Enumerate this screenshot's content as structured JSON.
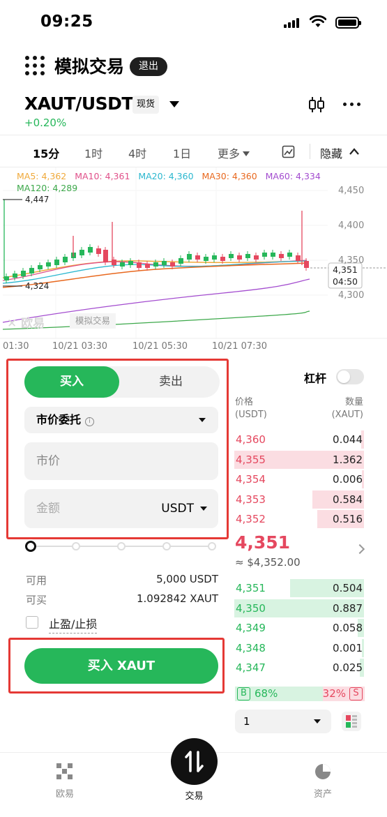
{
  "status": {
    "time": "09:25"
  },
  "header": {
    "title": "模拟交易",
    "exit_label": "退出"
  },
  "pair": {
    "name": "XAUT/USDT",
    "tag": "现货",
    "change": "+0.20%"
  },
  "timeframes": {
    "items": [
      "15分",
      "1时",
      "4时",
      "1日",
      "更多"
    ],
    "active": "15分",
    "hide_label": "隐藏"
  },
  "chart": {
    "ma": [
      {
        "label": "MA5: 4,362",
        "color": "#f0a93a"
      },
      {
        "label": "MA10: 4,361",
        "color": "#e0508a"
      },
      {
        "label": "MA20: 4,360",
        "color": "#2bb7cf"
      },
      {
        "label": "MA30: 4,360",
        "color": "#e8681e"
      },
      {
        "label": "MA60: 4,334",
        "color": "#a34ccf"
      },
      {
        "label": "MA120: 4,289",
        "color": "#3ca84a"
      }
    ],
    "y_ticks": [
      "4,450",
      "4,400",
      "4,350",
      "4,300"
    ],
    "high_label": "4,447",
    "low_label": "4,324",
    "current_price": "4,351",
    "countdown": "04:50",
    "x_ticks": [
      "01:30",
      "10/21 03:30",
      "10/21 05:30",
      "10/21 07:30"
    ],
    "watermark_brand": "欧易",
    "watermark_tag": "模拟交易"
  },
  "trade": {
    "buy_tab": "买入",
    "sell_tab": "卖出",
    "order_type": "市价委托",
    "price_placeholder": "市价",
    "amount_placeholder": "金额",
    "amount_unit": "USDT",
    "available_label": "可用",
    "available_value": "5,000 USDT",
    "buyable_label": "可买",
    "buyable_value": "1.092842 XAUT",
    "tpsl_label": "止盈/止损",
    "submit_label": "买入 XAUT",
    "slider_percent": 0
  },
  "orderbook": {
    "leverage_label": "杠杆",
    "price_header": "价格",
    "price_unit": "(USDT)",
    "qty_header": "数量",
    "qty_unit": "(XAUT)",
    "asks": [
      {
        "price": "4,360",
        "qty": "0.044",
        "depth": 0.02
      },
      {
        "price": "4,355",
        "qty": "1.362",
        "depth": 1.0
      },
      {
        "price": "4,354",
        "qty": "0.006",
        "depth": 0.01
      },
      {
        "price": "4,353",
        "qty": "0.584",
        "depth": 0.4
      },
      {
        "price": "4,352",
        "qty": "0.516",
        "depth": 0.36
      }
    ],
    "last_price": "4,351",
    "last_usd": "≈ $4,352.00",
    "bids": [
      {
        "price": "4,351",
        "qty": "0.504",
        "depth": 0.57
      },
      {
        "price": "4,350",
        "qty": "0.887",
        "depth": 1.0
      },
      {
        "price": "4,349",
        "qty": "0.058",
        "depth": 0.05
      },
      {
        "price": "4,348",
        "qty": "0.001",
        "depth": 0.01
      },
      {
        "price": "4,347",
        "qty": "0.025",
        "depth": 0.03
      }
    ],
    "buy_tag": "B",
    "buy_ratio": "68%",
    "sell_ratio": "32%",
    "sell_tag": "S",
    "depth_value": "1"
  },
  "nav": {
    "home": "欧易",
    "trade": "交易",
    "assets": "资产"
  }
}
